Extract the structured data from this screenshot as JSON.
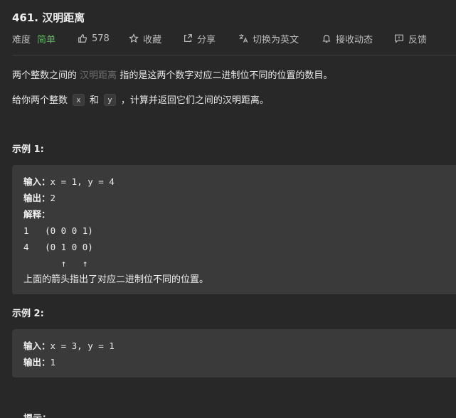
{
  "problem": {
    "title": "461. 汉明距离"
  },
  "toolbar": {
    "difficulty_label": "难度",
    "difficulty_value": "简单",
    "likes": "578",
    "favorite": "收藏",
    "share": "分享",
    "translate": "切换为英文",
    "notify": "接收动态",
    "feedback": "反馈"
  },
  "description": {
    "line1_before": "两个整数之间的",
    "line1_term": "汉明距离",
    "line1_after": "指的是这两个数字对应二进制位不同的位置的数目。",
    "line2_before": "给你两个整数",
    "line2_x": "x",
    "line2_and": "和",
    "line2_y": "y",
    "line2_after": "，计算并返回它们之间的汉明距离。"
  },
  "example1": {
    "title": "示例 1:",
    "input_label": "输入：",
    "input_value": "x = 1, y = 4",
    "output_label": "输出：",
    "output_value": "2",
    "explain_label": "解释：",
    "row1": "1   (0 0 0 1)",
    "row2": "4   (0 1 0 0)",
    "arrows": "       ↑   ↑",
    "note": "上面的箭头指出了对应二进制位不同的位置。"
  },
  "example2": {
    "title": "示例 2:",
    "input_label": "输入：",
    "input_value": "x = 3, y = 1",
    "output_label": "输出：",
    "output_value": "1"
  },
  "hint_title": "提示："
}
